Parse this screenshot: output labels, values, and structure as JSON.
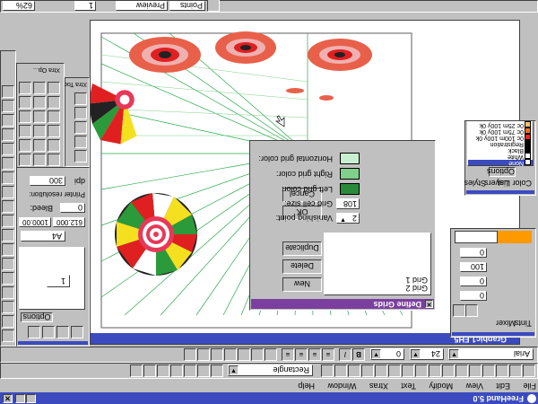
{
  "app": {
    "title": "FreeHand 5.0",
    "menu": [
      "File",
      "Edit",
      "View",
      "Modify",
      "Text",
      "Xtras",
      "Window",
      "Help"
    ],
    "document_title": "Graphic1.FH5"
  },
  "toolbar_top": {
    "shape_select": "Rectangle",
    "font_name": "Arial",
    "font_size": "24",
    "leading": "0"
  },
  "status_bar": {
    "zoom": "62%",
    "view_mode": "Preview",
    "units": "Points",
    "page": "1"
  },
  "dialog": {
    "title": "Define Grids",
    "list_label": "Grid 1",
    "list_items": [
      "Grid 1",
      "Grid 2"
    ],
    "vanishing_label": "Vanishing point:",
    "vanishing_value": "2",
    "cell_size_label": "Grid cell size:",
    "cell_size_value": "108",
    "left_color_label": "Left grid color:",
    "right_color_label": "Right grid color:",
    "horizontal_color_label": "Horizontal grid color:",
    "buttons": {
      "cancel": "Cancel",
      "ok": "OK",
      "duplicate": "Duplicate",
      "delete": "Delete",
      "new": "New"
    },
    "colors": {
      "left": "#2a8a3a",
      "right": "#7fd08a",
      "horizontal": "#c8f0d0"
    }
  },
  "color_list": {
    "tabs": [
      "Color List",
      "Layers",
      "Styles"
    ],
    "options": "Options",
    "items": [
      "None",
      "White",
      "Black",
      "Registration",
      "0c 100m 100y 0k",
      "0c 75m 100y 0k",
      "0c 25m 100y 0k"
    ],
    "swatches": [
      "#ffffff",
      "#ffffff",
      "#000000",
      "#000000",
      "#ff2020",
      "#ff7020",
      "#ffc060"
    ]
  },
  "tints_panel": {
    "tabs": [
      "Tints",
      "Mixer"
    ],
    "values": [
      "0",
      "0",
      "100",
      "0"
    ],
    "preview_color": "#ff9900"
  },
  "xtra_tools": {
    "title": "Xtra Tools"
  },
  "xtra_ops": {
    "title": "Xtra Op..."
  },
  "inspector": {
    "options": "Options",
    "printer_res_label": "Printer resolution:",
    "printer_res_value": "300",
    "printer_res_unit": "dpi",
    "bleed_label": "Bleed:",
    "bleed_value": "0",
    "width_value": "612.000",
    "height_value": "1000.00",
    "page_size": "A4",
    "page_num": "1"
  }
}
